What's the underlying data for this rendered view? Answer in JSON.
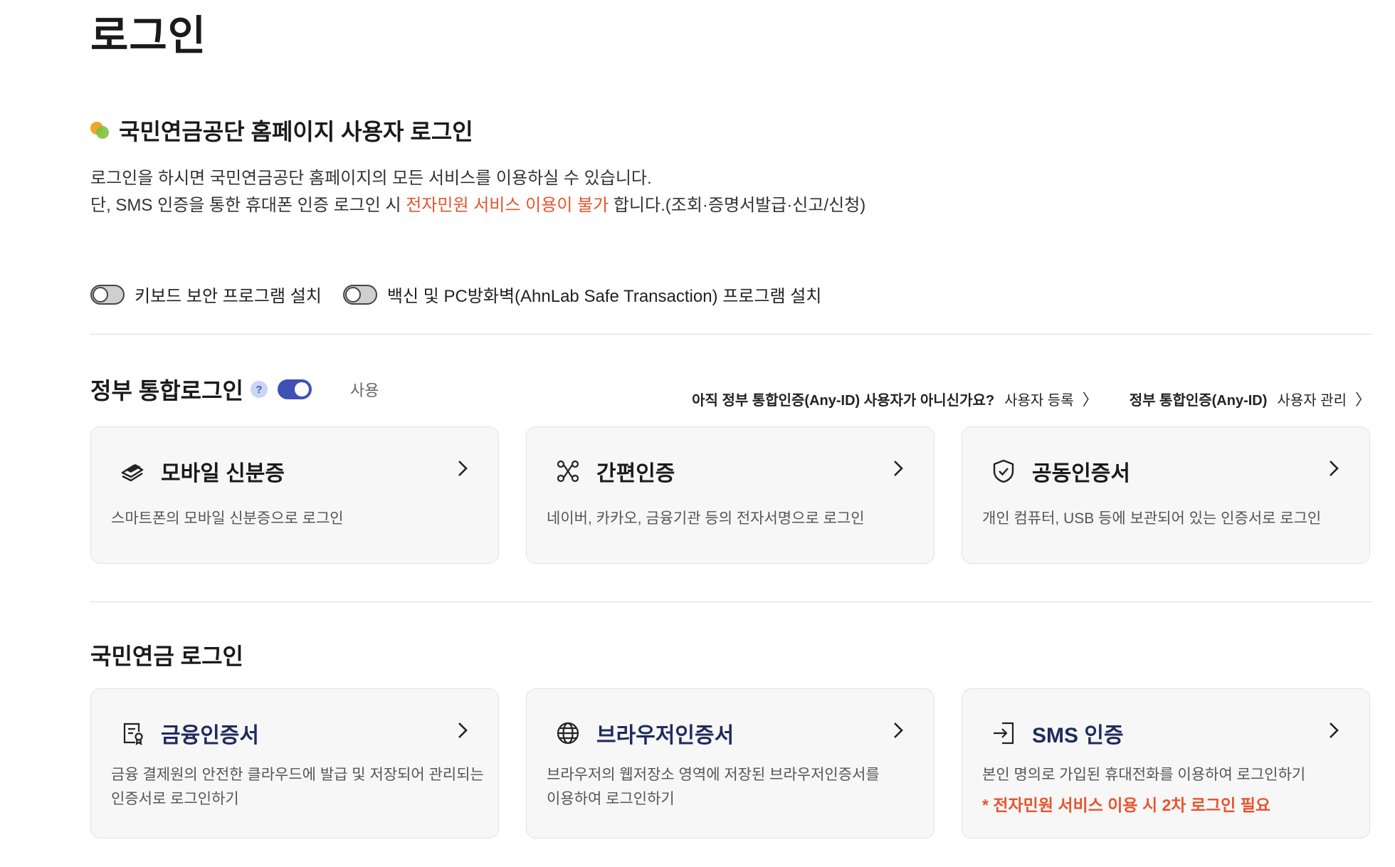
{
  "page": {
    "title": "로그인"
  },
  "section": {
    "title": "국민연금공단 홈페이지 사용자 로그인",
    "desc_line1": "로그인을 하시면 국민연금공단 홈페이지의 모든 서비스를 이용하실 수 있습니다.",
    "desc_line2_pre": "단, SMS 인증을 통한 휴대폰 인증 로그인 시 ",
    "desc_line2_warn": "전자민원 서비스 이용이 불가",
    "desc_line2_post": " 합니다.(조회·증명서발급·신고/신청)"
  },
  "toggles": [
    {
      "label": "키보드 보안 프로그램 설치",
      "state": "off"
    },
    {
      "label": "백신 및 PC방화벽(AhnLab Safe Transaction) 프로그램 설치",
      "state": "off"
    }
  ],
  "gov": {
    "title": "정부 통합로그인",
    "help": "?",
    "use_label": "사용",
    "toggle_state": "on",
    "link1_question": "아직 정부 통합인증(Any-ID) 사용자가 아니신가요?",
    "link1_label": "사용자 등록",
    "link2_prefix": "정부 통합인증(Any-ID)",
    "link2_label": "사용자 관리",
    "cards": [
      {
        "title": "모바일 신분증",
        "desc": "스마트폰의 모바일 신분증으로 로그인",
        "icon": "mobile-id-icon"
      },
      {
        "title": "간편인증",
        "desc": "네이버, 카카오, 금융기관 등의 전자서명으로 로그인",
        "icon": "simple-auth-icon"
      },
      {
        "title": "공동인증서",
        "desc": "개인 컴퓨터, USB 등에 보관되어 있는 인증서로 로그인",
        "icon": "shield-check-icon"
      }
    ]
  },
  "nps": {
    "title": "국민연금 로그인",
    "cards": [
      {
        "title": "금융인증서",
        "desc1": "금융 결제원의 안전한 클라우드에 발급 및 저장되어 관리되는",
        "desc2": "인증서로 로그인하기",
        "icon": "financial-cert-icon"
      },
      {
        "title": "브라우저인증서",
        "desc1": "브라우저의 웹저장소 영역에 저장된 브라우저인증서를",
        "desc2": "이용하여 로그인하기",
        "icon": "globe-icon"
      },
      {
        "title": "SMS 인증",
        "desc1": "본인 명의로 가입된 휴대전화를 이용하여 로그인하기",
        "warn": "* 전자민원 서비스 이용 시 2차 로그인 필요",
        "icon": "login-arrow-icon"
      }
    ]
  },
  "colors": {
    "accent": "#3f51b5",
    "warning": "#e8542e",
    "card_bg": "#f7f7f7",
    "nps_title": "#1f2b5e"
  }
}
